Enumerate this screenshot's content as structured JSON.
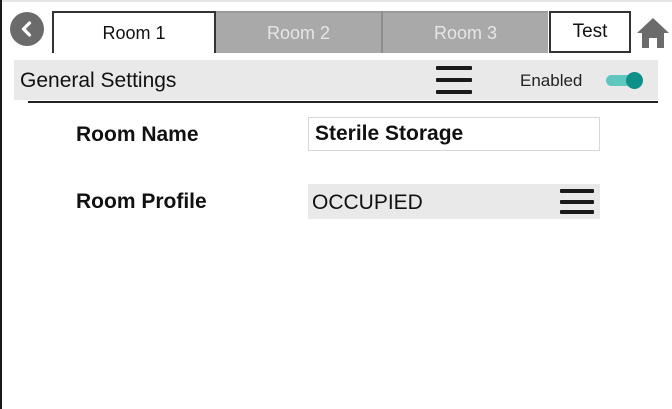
{
  "tabs": [
    {
      "label": "Room 1",
      "state": "active"
    },
    {
      "label": "Room 2",
      "state": "inactive"
    },
    {
      "label": "Room 3",
      "state": "inactive"
    },
    {
      "label": "Test",
      "state": "active"
    }
  ],
  "icons": {
    "back": "chevron-left-icon",
    "home": "home-icon",
    "menu": "hamburger-menu-icon"
  },
  "general_settings": {
    "title": "General Settings",
    "enabled_label": "Enabled",
    "enabled": true
  },
  "room_name": {
    "label": "Room Name",
    "value": "Sterile Storage"
  },
  "room_profile": {
    "label": "Room Profile",
    "value": "OCCUPIED"
  },
  "colors": {
    "toggle_knob": "#0e8f88",
    "toggle_track": "#5fc6c0",
    "inactive_tab": "#a9a9a9",
    "section_background": "#e9e9e9"
  }
}
